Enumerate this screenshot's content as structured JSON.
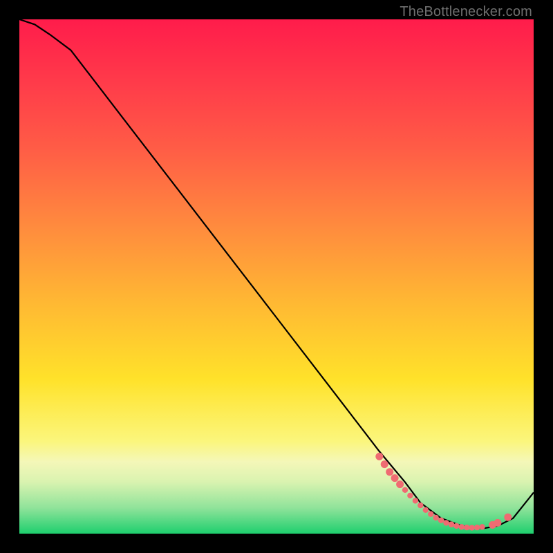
{
  "attribution": "TheBottlenecker.com",
  "colors": {
    "gradient_top": "#ff1c4b",
    "gradient_bottom": "#1ecf6e",
    "line": "#000000",
    "dot": "#ef6b72"
  },
  "chart_data": {
    "type": "line",
    "title": "",
    "xlabel": "",
    "ylabel": "",
    "xlim": [
      0,
      100
    ],
    "ylim": [
      0,
      100
    ],
    "series": [
      {
        "name": "bottleneck-curve",
        "x": [
          0,
          3,
          6,
          10,
          20,
          30,
          40,
          50,
          60,
          70,
          75,
          78,
          82,
          86,
          90,
          93,
          96,
          100
        ],
        "y": [
          100,
          99,
          97,
          94,
          81,
          68,
          55,
          42,
          29,
          16,
          10,
          6,
          3,
          1.5,
          1,
          1.5,
          3,
          8
        ]
      }
    ],
    "markers": {
      "name": "dense-dot-band",
      "x": [
        70,
        71,
        72,
        73,
        74,
        75,
        76,
        77,
        78,
        79,
        80,
        81,
        82,
        83,
        84,
        85,
        86,
        87,
        88,
        89,
        90,
        92,
        93,
        95
      ],
      "y": [
        15,
        13.5,
        12,
        10.8,
        9.6,
        8.5,
        7.4,
        6.4,
        5.5,
        4.6,
        3.8,
        3.1,
        2.6,
        2.1,
        1.8,
        1.5,
        1.3,
        1.2,
        1.15,
        1.2,
        1.3,
        1.7,
        2.1,
        3.2
      ]
    }
  }
}
